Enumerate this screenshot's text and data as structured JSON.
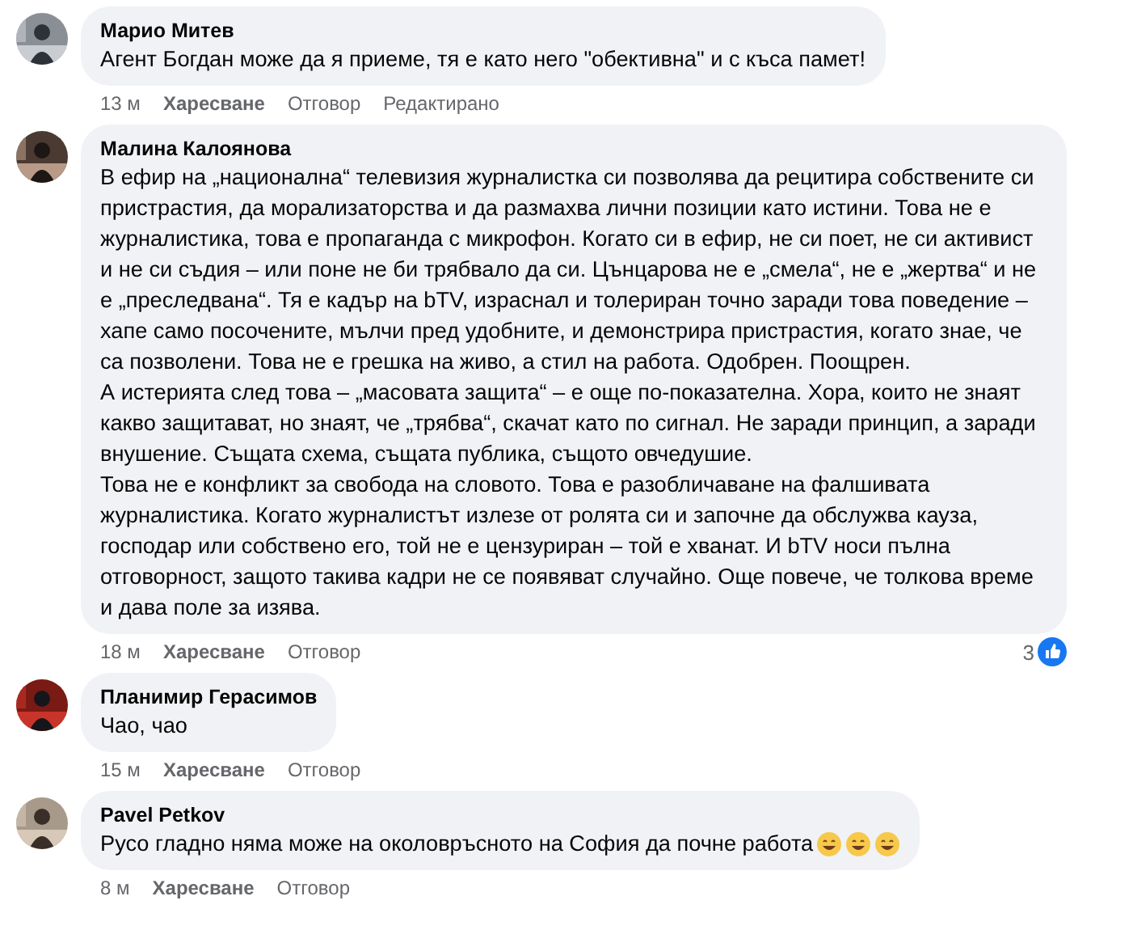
{
  "comments": [
    {
      "author": "Марио Митев",
      "paragraphs": [
        "Агент Богдан може да я приеме, тя е като него \"обективна\" и с къса памет!"
      ],
      "time": "13 м",
      "actions": [
        "Харесване",
        "Отговор"
      ],
      "edited": "Редактирано"
    },
    {
      "author": "Малина Калоянова",
      "paragraphs": [
        "В ефир на „национална“ телевизия журналистка си позволява да рецитира собствените си пристрастия, да морализаторства и да размахва лични позиции като истини. Това не е журналистика, това е пропаганда с микрофон. Когато си в ефир, не си поет, не си активист и не си съдия – или поне не би трябвало да си. Цънцарова не е „смела“, не е „жертва“ и не е „преследвана“. Тя е кадър на bTV, израснал и толериран точно заради това поведение – хапе само посочените, мълчи пред удобните, и демонстрира пристрастия, когато знае, че са позволени. Това не е грешка на живо, а стил на работа. Одобрен. Поощрен.",
        "А истерията след това – „масовата защита“ – е още по-показателна. Хора, които не знаят какво защитават, но знаят, че „трябва“, скачат като по сигнал. Не заради принцип, а заради внушение. Същата схема, същата публика, същото овчедушие.",
        "Това не е конфликт за свобода на словото. Това е разобличаване на фалшивата журналистика. Когато журналистът излезе от ролята си и започне да обслужва кауза, господар или собствено его, той не е цензуриран – той е хванат. И bTV носи пълна отговорност, защото такива кадри не се появяват случайно. Още повече, че толкова време и дава поле за изява."
      ],
      "time": "18 м",
      "actions": [
        "Харесване",
        "Отговор"
      ],
      "reactions": "3"
    },
    {
      "author": "Планимир Герасимов",
      "paragraphs": [
        "Чао, чао"
      ],
      "time": "15 м",
      "actions": [
        "Харесване",
        "Отговор"
      ]
    },
    {
      "author": "Pavel Petkov",
      "paragraphs": [
        "Русо гладно няма може на околовръсното на София да почне работа"
      ],
      "emojis": [
        {
          "kind": "grin"
        },
        {
          "kind": "grin"
        },
        {
          "kind": "grin"
        }
      ],
      "time": "8 м",
      "actions": [
        "Харесване",
        "Отговор"
      ]
    }
  ]
}
